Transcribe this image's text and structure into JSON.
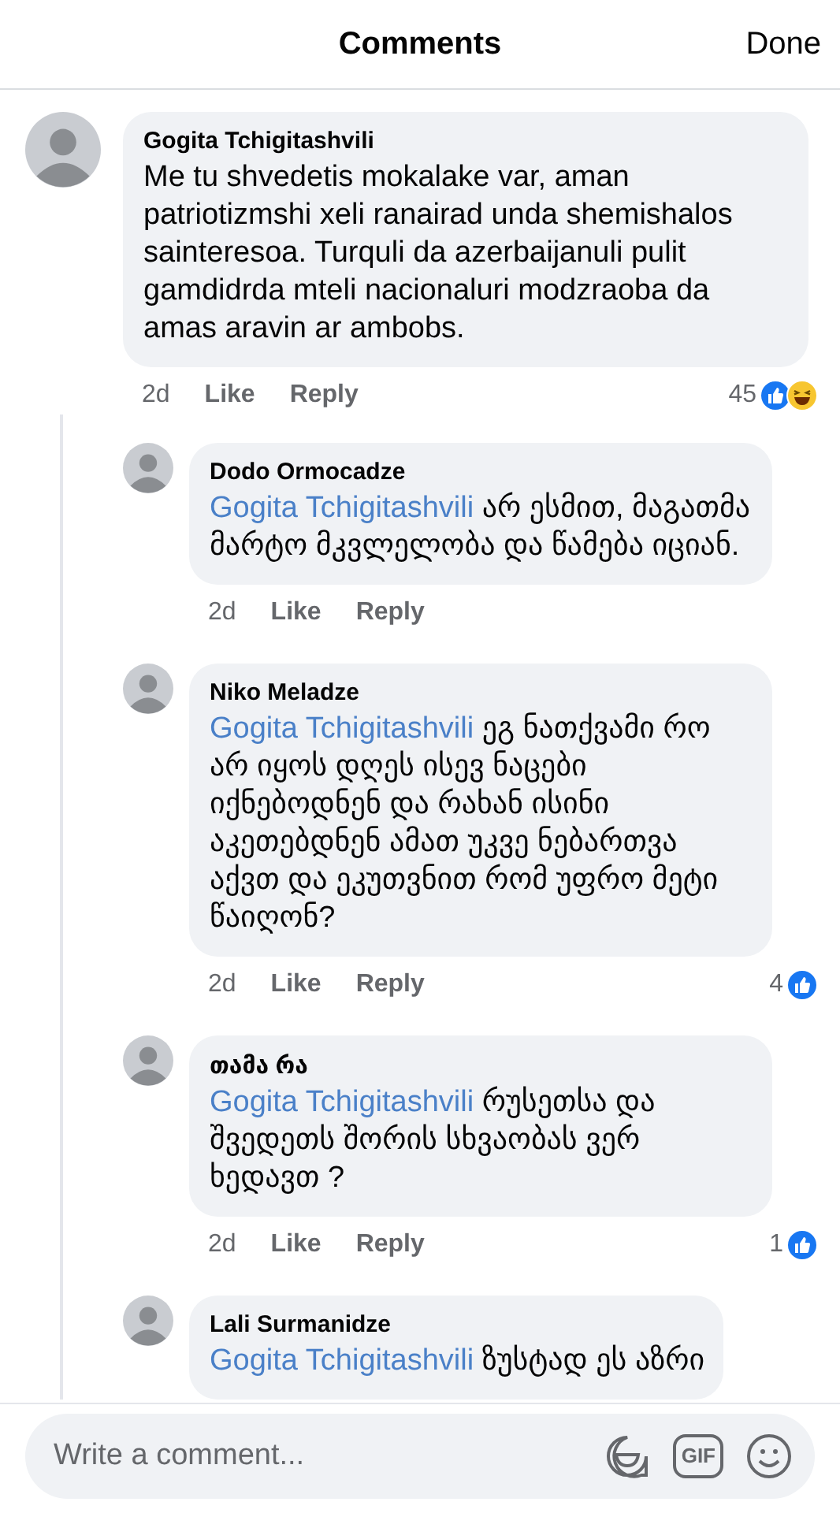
{
  "header": {
    "title": "Comments",
    "done": "Done"
  },
  "comments": [
    {
      "author": "Gogita Tchigitashvili",
      "text": "Me tu shvedetis mokalake var, aman patriotizmshi xeli ranairad unda shemishalos sainteresoa. Turquli da azerbaijanuli pulit gamdidrda mteli nacionaluri modzraoba da amas aravin ar ambobs.",
      "time": "2d",
      "like": "Like",
      "reply": "Reply",
      "reaction_count": "45",
      "reactions": [
        {
          "kind": "like"
        },
        {
          "kind": "haha"
        }
      ],
      "replies": [
        {
          "author": "Dodo Ormocadze",
          "mention": "Gogita Tchigitashvili",
          "text": "არ ესმით, მაგათმა მარტო მკვლელობა და წამება იციან.",
          "time": "2d",
          "like": "Like",
          "reply": "Reply"
        },
        {
          "author": "Niko Meladze",
          "mention": "Gogita Tchigitashvili",
          "text": "ეგ ნათქვამი რო არ იყოს დღეს ისევ ნაცები იქნებოდნენ და რახან ისინი აკეთებდნენ ამათ უკვე ნებართვა აქვთ და ეკუთვნით რომ უფრო მეტი წაიღონ?",
          "time": "2d",
          "like": "Like",
          "reply": "Reply",
          "reaction_count": "4",
          "reactions": [
            {
              "kind": "like"
            }
          ]
        },
        {
          "author": "თამა რა",
          "mention": "Gogita Tchigitashvili",
          "text": "რუსეთსა და შვედეთს შორის სხვაობას ვერ ხედავთ ?",
          "time": "2d",
          "like": "Like",
          "reply": "Reply",
          "reaction_count": "1",
          "reactions": [
            {
              "kind": "like"
            }
          ]
        },
        {
          "author": "Lali Surmanidze",
          "mention": "Gogita Tchigitashvili",
          "text": "ზუსტად ეს აზრი"
        }
      ]
    }
  ],
  "composer": {
    "placeholder": "Write a comment...",
    "gif": "GIF"
  }
}
